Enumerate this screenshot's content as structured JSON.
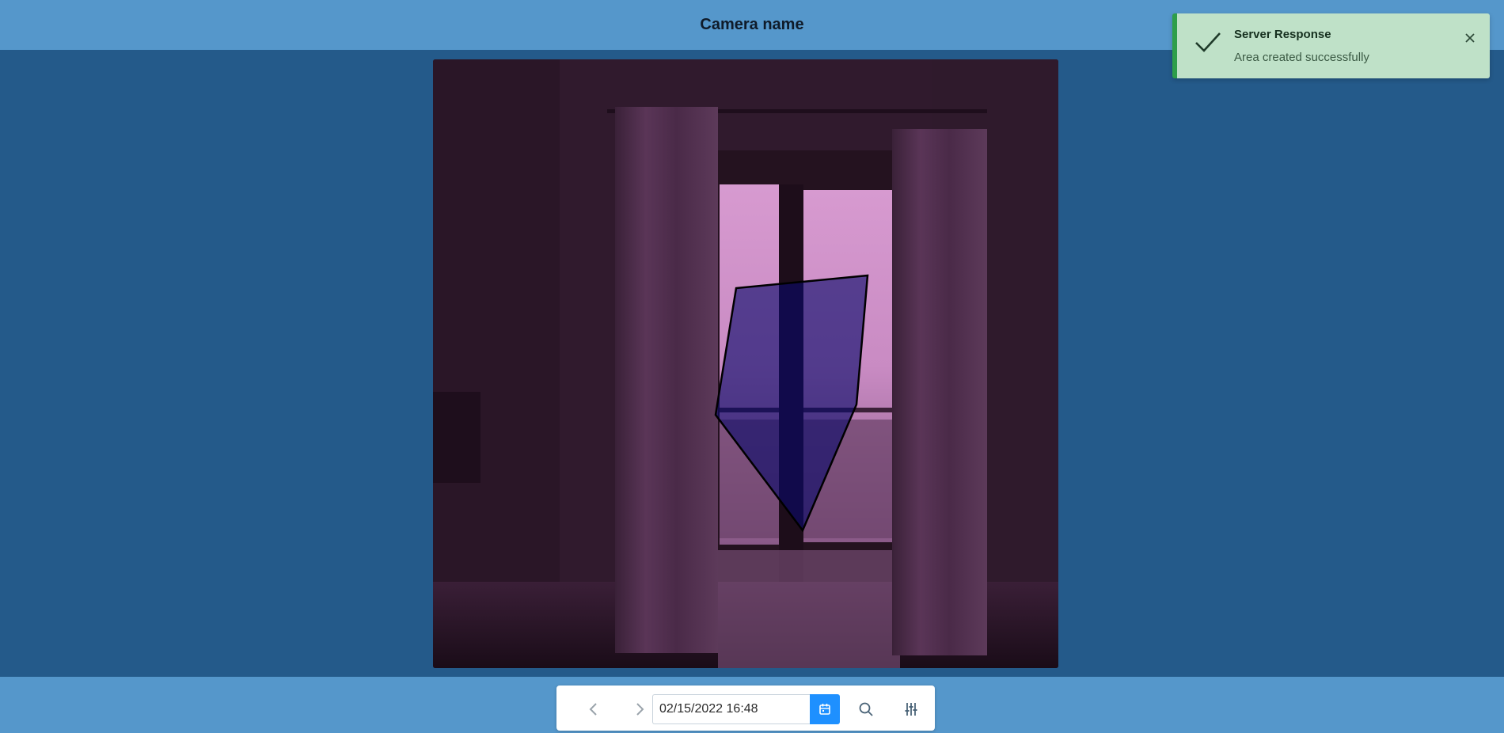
{
  "header": {
    "title": "Camera name"
  },
  "camera_view": {
    "image_icon": "camera-feed-image",
    "area_shape": "polygon-area-overlay"
  },
  "toolbar": {
    "prev_icon": "chevron-left-icon",
    "next_icon": "chevron-right-icon",
    "date_value": "02/15/2022 16:48",
    "calendar_icon": "calendar-icon",
    "search_icon": "search-icon",
    "settings_icon": "sliders-icon"
  },
  "toast": {
    "title": "Server Response",
    "message": "Area created successfully",
    "status_icon": "checkmark-icon",
    "close_icon": "close-icon"
  },
  "colors": {
    "header_bg": "#5597cb",
    "page_bg": "#245a8a",
    "accent": "#1e90ff",
    "toast_bg": "#bfe1c8",
    "toast_border": "#2e9e4a"
  }
}
